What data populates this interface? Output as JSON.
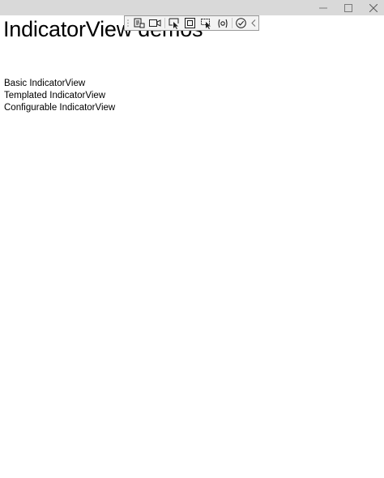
{
  "window": {
    "controls": {
      "minimize_icon": "minimize-icon",
      "maximize_icon": "maximize-icon",
      "close_icon": "close-icon"
    },
    "titlebar_color": "#d9d9d9"
  },
  "page": {
    "title": "IndicatorView demos"
  },
  "demos": [
    {
      "label": "Basic IndicatorView"
    },
    {
      "label": "Templated IndicatorView"
    },
    {
      "label": "Configurable IndicatorView"
    }
  ],
  "debug_toolbar": {
    "buttons": [
      {
        "icon": "go-to-live-visual-tree-icon"
      },
      {
        "icon": "record-icon"
      },
      {
        "icon": "select-element-icon"
      },
      {
        "icon": "display-layout-adorners-icon"
      },
      {
        "icon": "track-focus-icon"
      },
      {
        "icon": "binding-failures-icon"
      },
      {
        "icon": "accessibility-check-icon"
      },
      {
        "icon": "collapse-toolbar-icon"
      }
    ]
  }
}
